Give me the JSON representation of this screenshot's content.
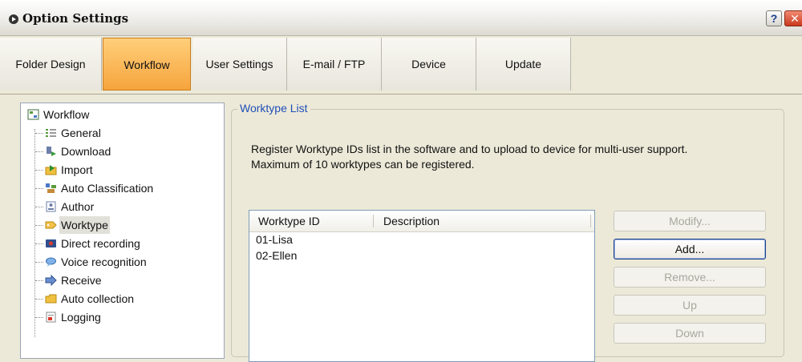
{
  "window": {
    "title": "Option Settings",
    "help_label": "?",
    "close_label": "✕"
  },
  "tabs": [
    {
      "label": "Folder Design",
      "active": false
    },
    {
      "label": "Workflow",
      "active": true
    },
    {
      "label": "User Settings",
      "active": false
    },
    {
      "label": "E-mail / FTP",
      "active": false
    },
    {
      "label": "Device",
      "active": false
    },
    {
      "label": "Update",
      "active": false
    }
  ],
  "tree": {
    "root": {
      "label": "Workflow",
      "icon": "workflow-icon"
    },
    "items": [
      {
        "label": "General",
        "icon": "general-icon"
      },
      {
        "label": "Download",
        "icon": "download-icon"
      },
      {
        "label": "Import",
        "icon": "import-icon"
      },
      {
        "label": "Auto Classification",
        "icon": "auto-classification-icon"
      },
      {
        "label": "Author",
        "icon": "author-icon"
      },
      {
        "label": "Worktype",
        "icon": "worktype-icon",
        "selected": true
      },
      {
        "label": "Direct recording",
        "icon": "direct-recording-icon"
      },
      {
        "label": "Voice recognition",
        "icon": "voice-recognition-icon"
      },
      {
        "label": "Receive",
        "icon": "receive-icon"
      },
      {
        "label": "Auto collection",
        "icon": "auto-collection-icon"
      },
      {
        "label": "Logging",
        "icon": "logging-icon"
      }
    ]
  },
  "worktype_list": {
    "legend": "Worktype List",
    "description": "Register Worktype IDs list in the software and to upload to device for multi-user support. Maximum of 10 worktypes can be registered.",
    "columns": [
      "Worktype ID",
      "Description"
    ],
    "rows": [
      {
        "id": "01-Lisa",
        "description": ""
      },
      {
        "id": "02-Ellen",
        "description": ""
      }
    ]
  },
  "buttons": {
    "modify": "Modify...",
    "add": "Add...",
    "remove": "Remove...",
    "up": "Up",
    "down": "Down"
  },
  "colors": {
    "active_tab": "#f6a43d",
    "legend": "#1f4fb8",
    "background": "#ece9d8"
  }
}
